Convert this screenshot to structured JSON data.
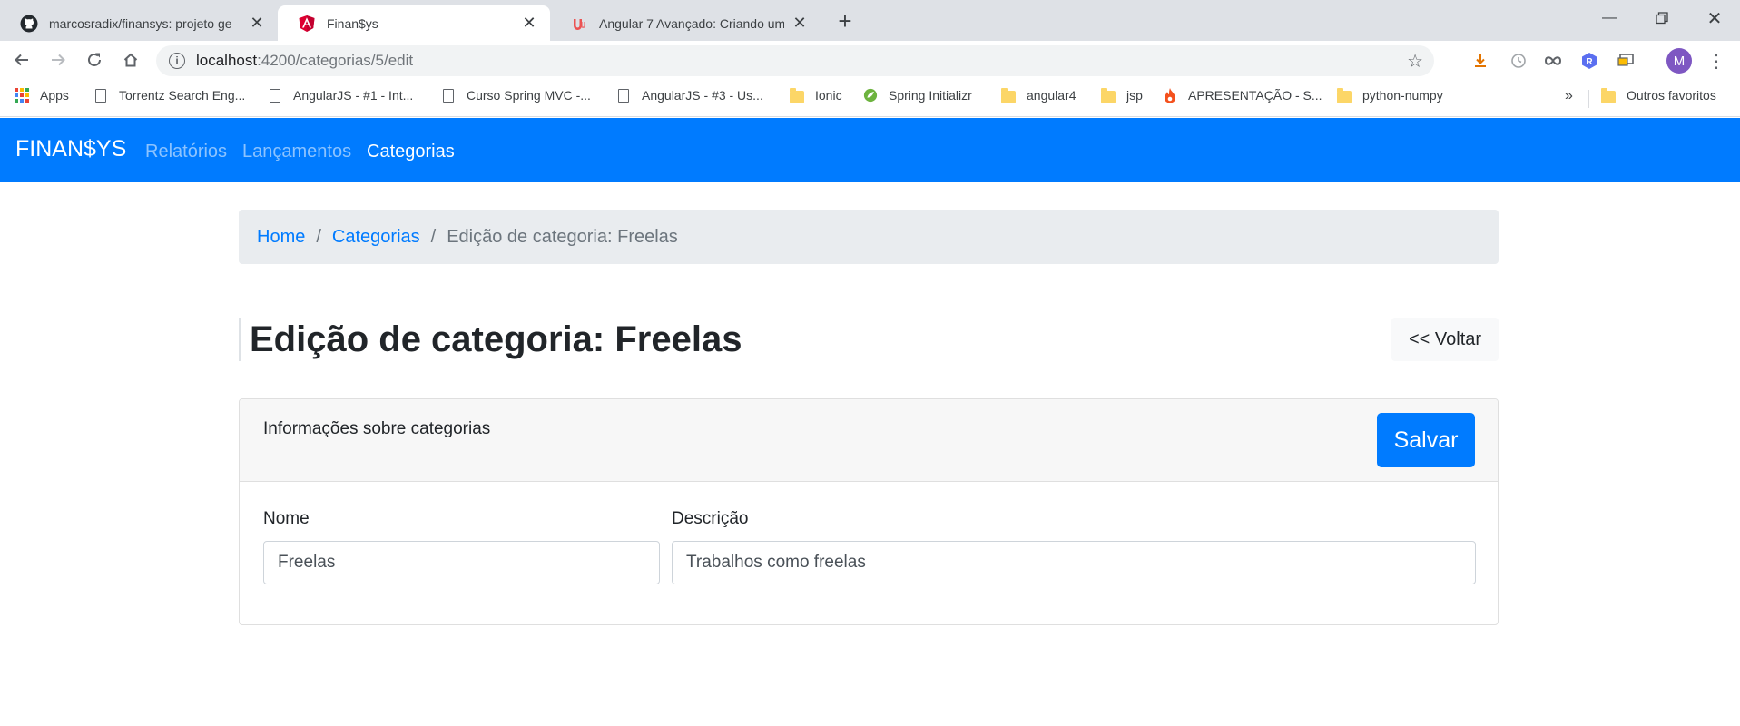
{
  "browser": {
    "tabs": [
      {
        "title": "marcosradix/finansys: projeto ge",
        "active": false
      },
      {
        "title": "Finan$ys",
        "active": true
      },
      {
        "title": "Angular 7 Avançado: Criando um",
        "active": false
      }
    ],
    "address": {
      "host": "localhost",
      "path": ":4200/categorias/5/edit"
    },
    "bookmarks": [
      {
        "label": "Apps",
        "icon": "apps-icon"
      },
      {
        "label": "Torrentz Search Eng...",
        "icon": "page-icon"
      },
      {
        "label": "AngularJS - #1 - Int...",
        "icon": "page-icon"
      },
      {
        "label": "Curso Spring MVC -...",
        "icon": "page-icon"
      },
      {
        "label": "AngularJS - #3 - Us...",
        "icon": "page-icon"
      },
      {
        "label": "Ionic",
        "icon": "folder-icon"
      },
      {
        "label": "Spring Initializr",
        "icon": "spring-icon"
      },
      {
        "label": "angular4",
        "icon": "folder-icon"
      },
      {
        "label": "jsp",
        "icon": "folder-icon"
      },
      {
        "label": "APRESENTAÇÃO - S...",
        "icon": "fire-icon"
      },
      {
        "label": "python-numpy",
        "icon": "folder-icon"
      }
    ],
    "bookmarks_overflow": "»",
    "other_bookmarks": "Outros favoritos",
    "profile_initial": "M",
    "ext_r_initial": "R"
  },
  "navbar": {
    "brand": "FINAN$YS",
    "links": [
      {
        "label": "Relatórios",
        "active": false
      },
      {
        "label": "Lançamentos",
        "active": false
      },
      {
        "label": "Categorias",
        "active": true
      }
    ]
  },
  "breadcrumb": {
    "home": "Home",
    "categorias": "Categorias",
    "current": "Edição de categoria: Freelas",
    "separator": "/"
  },
  "page": {
    "title": "Edição de categoria: Freelas",
    "back_label": "<< Voltar"
  },
  "form": {
    "header": "Informações sobre categorias",
    "save_label": "Salvar",
    "nome_label": "Nome",
    "nome_value": "Freelas",
    "descricao_label": "Descrição",
    "descricao_value": "Trabalhos como freelas"
  },
  "colors": {
    "primary": "#007bff",
    "navbar_bg": "#007bff",
    "breadcrumb_bg": "#e9ecef",
    "card_header_bg": "#f7f7f7"
  }
}
